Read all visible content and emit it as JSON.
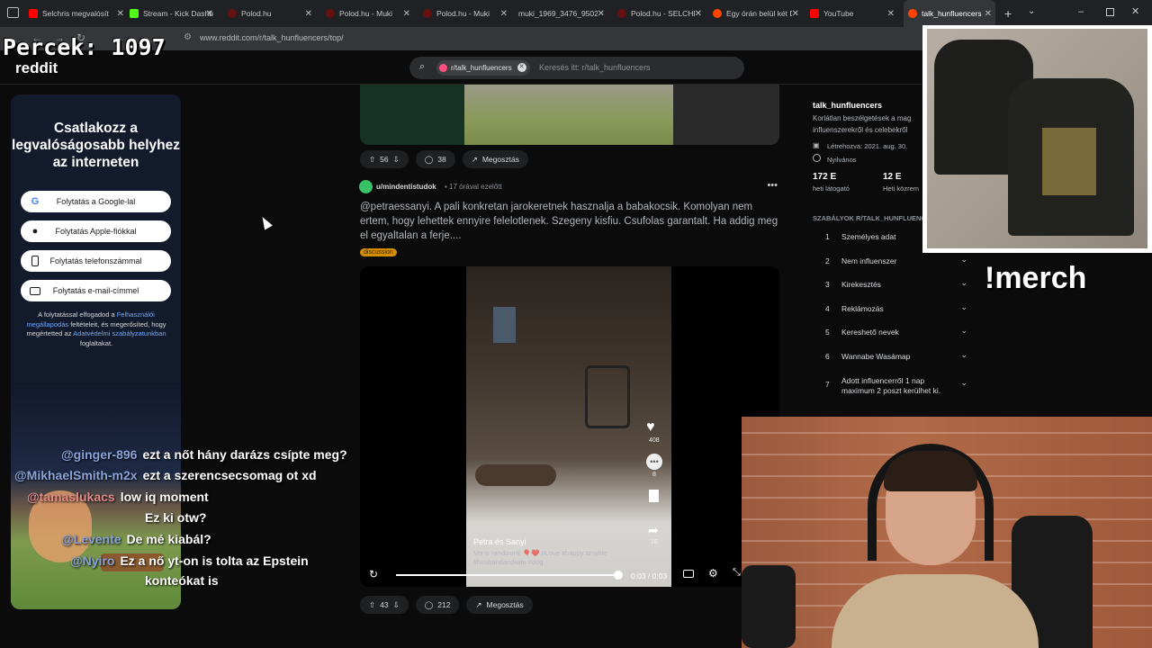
{
  "browser": {
    "tabs": [
      {
        "label": "Selchris megvalósít",
        "color": "#ff0000"
      },
      {
        "label": "Stream - Kick Dashb",
        "color": "#53fc18"
      },
      {
        "label": "Polod.hu",
        "color": "#d33"
      },
      {
        "label": "Polod.hu - Muki",
        "color": "#d33"
      },
      {
        "label": "Polod.hu - Muki",
        "color": "#d33"
      },
      {
        "label": "muki_1969_3476_9502_",
        "color": "#444"
      },
      {
        "label": "Polod.hu - SELCHRI",
        "color": "#d33"
      },
      {
        "label": "Egy órán belül két D",
        "color": "#ff4500"
      },
      {
        "label": "YouTube",
        "color": "#ff0000"
      },
      {
        "label": "talk_hunfluencers",
        "color": "#ff4500"
      }
    ],
    "url": "www.reddit.com/r/talk_hunfluencers/top/"
  },
  "overlay": {
    "timer": "Percek: 1097",
    "reddit_label": "reddit",
    "merch": "!merch"
  },
  "search": {
    "chip": "r/talk_hunfluencers",
    "placeholder": "Keresés itt: r/talk_hunfluencers"
  },
  "login": {
    "title": "Csatlakozz a legvalóságosabb helyhez az interneten",
    "buttons": [
      "Folytatás a Google-lal",
      "Folytatás Apple-fiókkal",
      "Folytatás telefonszámmal",
      "Folytatás e-mail-címmel"
    ],
    "terms_pre": "A folytatással elfogadod a ",
    "terms_link1": "Felhasználói megállapodás",
    "terms_mid": " feltételeit, és megerősíted, hogy megértetted az ",
    "terms_link2": "Adatvédelmi szabályzatunkban",
    "terms_post": " foglaltakat."
  },
  "chat": [
    {
      "user": "@ginger-896",
      "text": "ezt a nőt hány darázs csípte meg?"
    },
    {
      "user": "@MikhaelSmith-m2x",
      "text": "ezt a szerencsecsomag ot xd"
    },
    {
      "user": "@tamaslukacs",
      "text": "low iq moment"
    },
    {
      "user": "",
      "text": "Ez ki otw?"
    },
    {
      "user": "@Levente",
      "text": "De mé kiabál?"
    },
    {
      "user": "@Nyiro",
      "text": "Ez a nő yt-on is tolta az Epstein"
    },
    {
      "user": "",
      "text": "konteókat is"
    }
  ],
  "post1": {
    "votes": "56",
    "comments": "38",
    "share": "Megosztás"
  },
  "post2": {
    "author": "u/mindentistudok",
    "time": "• 17 órával ezelőtt",
    "body": "@petraessanyi. A pali konkretan jarokeretnek hasznalja a babakocsik. Komolyan nem ertem, hogy lehettek ennyire felelotlenek. Szegeny kisfiu. Csufolas garantalt. Ha addig meg el egyaltalan a ferje....",
    "flair": "discussion",
    "video_caption": "Petra és Sanyi",
    "video_sub": "Ma is randizunk 🎈❤️ #Love #happy #mylife #husbandandwife #dog",
    "video_time": "0:03 / 0:03",
    "likes": "408",
    "side_count": "8",
    "side_count2": "16",
    "votes": "43",
    "comments": "212",
    "share": "Megosztás"
  },
  "sidebar": {
    "name": "talk_hunfluencers",
    "desc": "Korlátlan beszélgetések a mag influenszerekről és celebekről",
    "created": "Létrehozva: 2021. aug. 30.",
    "visibility": "Nyilvános",
    "stat1_value": "172 E",
    "stat1_label": "heti látogató",
    "stat2_value": "12 E",
    "stat2_label": "Heti közrem",
    "rules_title": "SZABÁLYOK R/TALK_HUNFLUENCERS",
    "rules": [
      {
        "n": "1",
        "t": "Személyes adat"
      },
      {
        "n": "2",
        "t": "Nem influenszer"
      },
      {
        "n": "3",
        "t": "Kirekesztés"
      },
      {
        "n": "4",
        "t": "Reklámozás"
      },
      {
        "n": "5",
        "t": "Kereshető nevek"
      },
      {
        "n": "6",
        "t": "Wannabe Wasámap"
      },
      {
        "n": "7",
        "t": "Adott influencerről 1 nap maximum 2 poszt kerülhet ki."
      }
    ]
  }
}
